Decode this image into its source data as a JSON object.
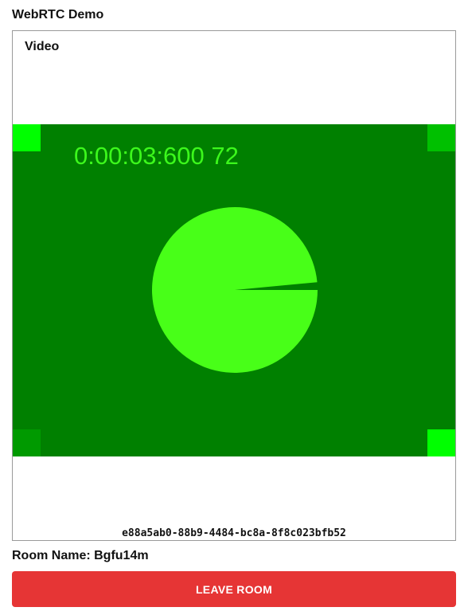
{
  "app": {
    "title": "WebRTC Demo"
  },
  "video_panel": {
    "heading": "Video",
    "stream": {
      "timecode": "0:00:03:600 72",
      "stream_id": "e88a5ab0-88b9-4484-bc8a-8f8c023bfb52",
      "pie_progress_fraction": 0.985,
      "colors": {
        "background": "#008000",
        "pie": "#48ff18",
        "text": "#3cf81c",
        "corner_top_left": "#00ff00",
        "corner_top_right": "#00c000",
        "corner_bottom_left": "#009a00",
        "corner_bottom_right": "#00ff00"
      }
    }
  },
  "room": {
    "label": "Room Name: Bgfu14m"
  },
  "actions": {
    "leave_label": "LEAVE ROOM",
    "leave_color": "#e63535"
  }
}
